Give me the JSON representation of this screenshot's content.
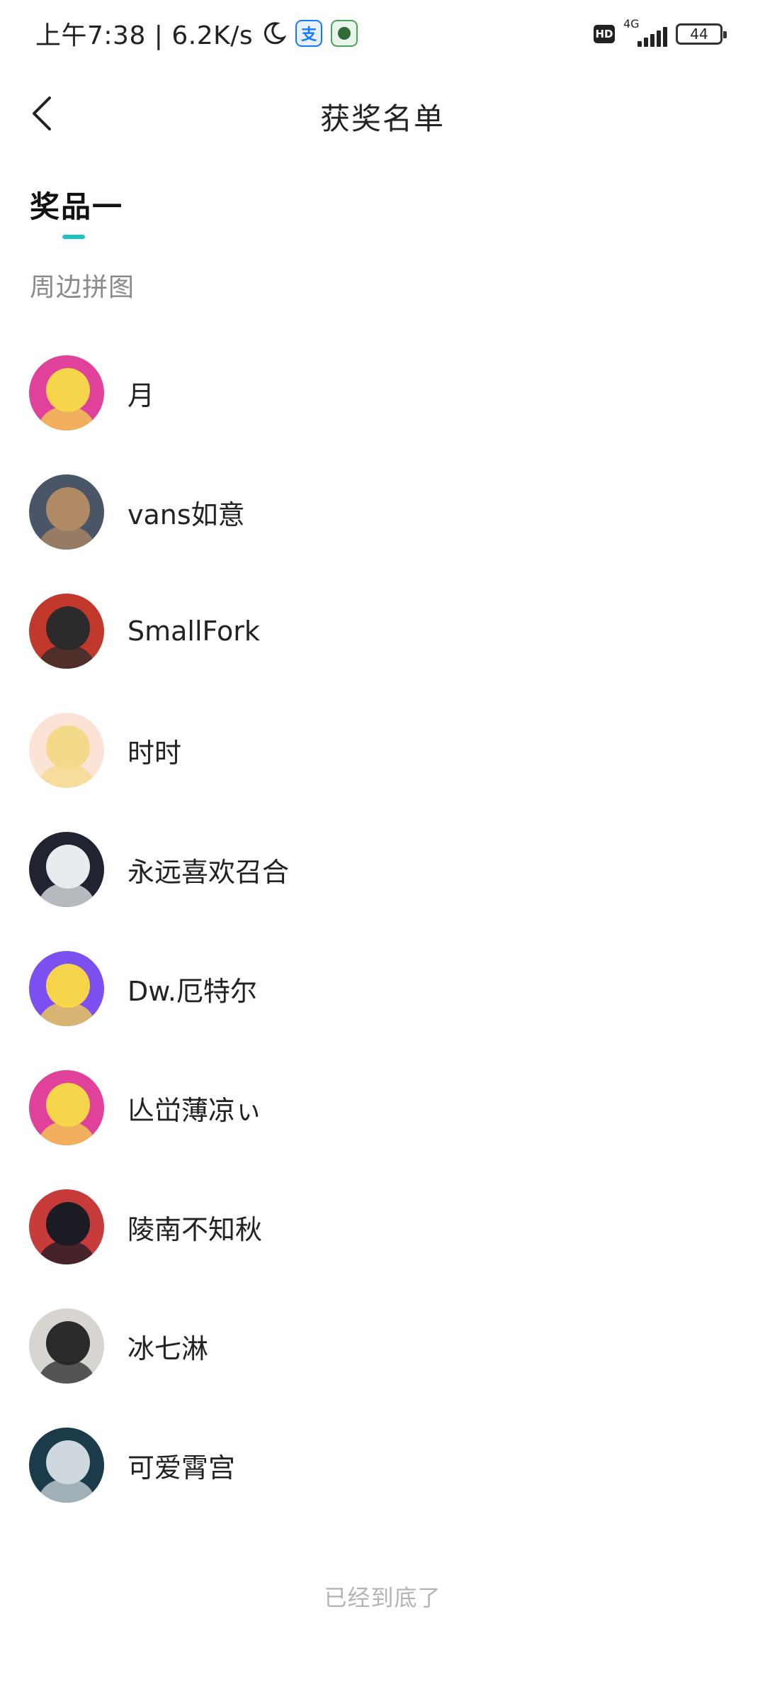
{
  "status_bar": {
    "time": "上午7:38 | 6.2K/s",
    "network_type": "4G",
    "battery": "44",
    "hd_label": "HD",
    "alipay_glyph": "支",
    "icons": [
      "moon-icon",
      "alipay-icon",
      "game-app-icon",
      "hd-icon",
      "signal-icon",
      "battery-icon"
    ]
  },
  "header": {
    "title": "获奖名单",
    "back_icon": "chevron-left-icon"
  },
  "tabs": [
    {
      "label": "奖品一",
      "active": true,
      "accent_color": "#1fc2c0"
    }
  ],
  "prize": {
    "name": "周边拼图"
  },
  "winners": [
    {
      "name": "月",
      "avatar_colors": [
        "#e0419a",
        "#f7d54a"
      ]
    },
    {
      "name": "vans如意",
      "avatar_colors": [
        "#4a5568",
        "#b08a64"
      ]
    },
    {
      "name": "SmallFork",
      "avatar_colors": [
        "#c0392b",
        "#2b2b2b"
      ]
    },
    {
      "name": "时时",
      "avatar_colors": [
        "#fbe3d6",
        "#f5d98a"
      ]
    },
    {
      "name": "永远喜欢召合",
      "avatar_colors": [
        "#1f2430",
        "#e9ecef"
      ]
    },
    {
      "name": "Dw.厄特尔",
      "avatar_colors": [
        "#7b4ff0",
        "#f7d54a"
      ]
    },
    {
      "name": "亾峃薄凉ぃ",
      "avatar_colors": [
        "#e0419a",
        "#f7d54a"
      ]
    },
    {
      "name": "陵南不知秋",
      "avatar_colors": [
        "#c73b3b",
        "#1c1c24"
      ]
    },
    {
      "name": "冰七淋",
      "avatar_colors": [
        "#d8d4cf",
        "#2a2a2a"
      ]
    },
    {
      "name": "可爱霄宫",
      "avatar_colors": [
        "#1b3a4a",
        "#cfd8dc"
      ]
    }
  ],
  "footer": {
    "end_text": "已经到底了"
  }
}
